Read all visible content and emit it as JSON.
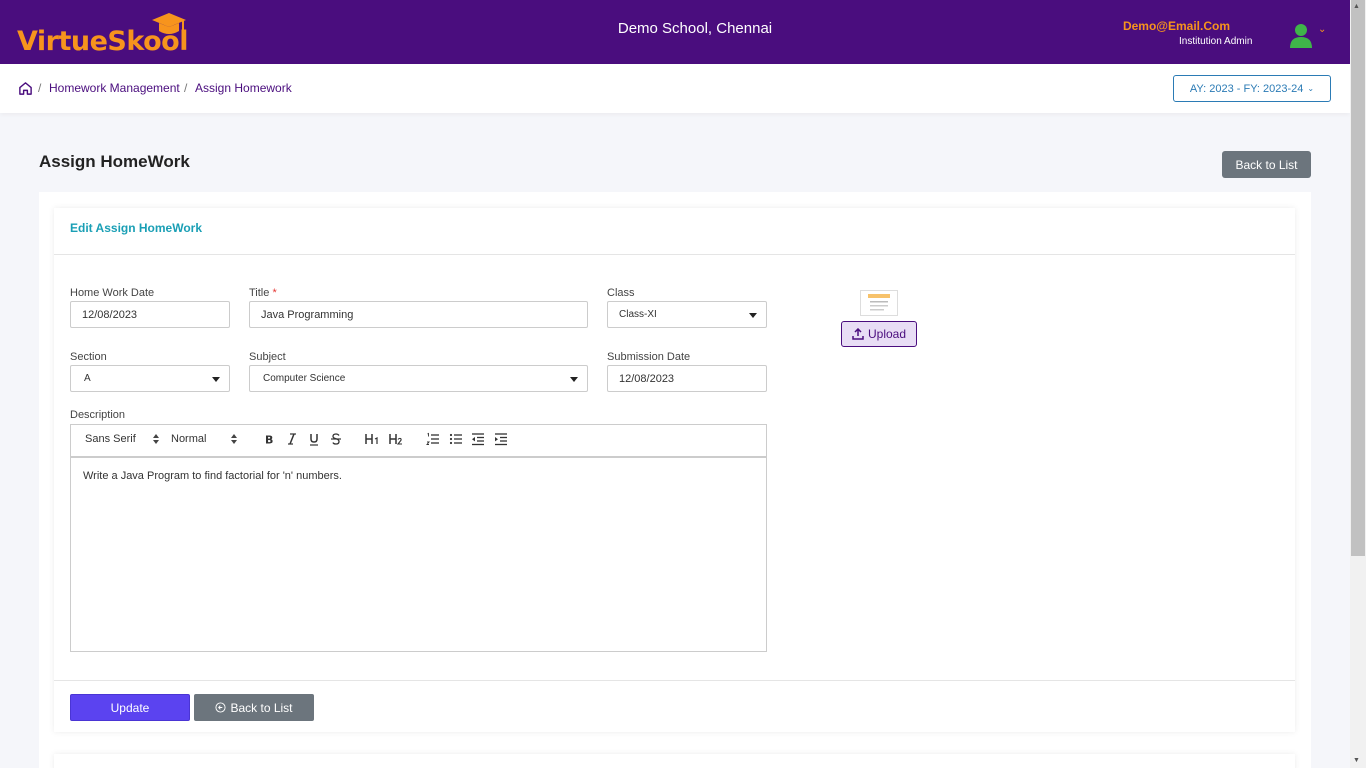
{
  "header": {
    "logo_text": "VirtueSkool",
    "school": "Demo School, Chennai",
    "user_email": "Demo@Email.Com",
    "user_role": "Institution Admin"
  },
  "breadcrumb": {
    "items": [
      "Homework Management",
      "Assign Homework"
    ],
    "separator": "/"
  },
  "academic_year": "AY: 2023 - FY: 2023-24",
  "page": {
    "title": "Assign HomeWork",
    "back_label": "Back to List"
  },
  "card": {
    "title": "Edit Assign HomeWork"
  },
  "form": {
    "homework_date": {
      "label": "Home Work Date",
      "value": "12/08/2023"
    },
    "title": {
      "label": "Title",
      "required_mark": "*",
      "value": "Java Programming"
    },
    "class": {
      "label": "Class",
      "value": "Class-XI"
    },
    "section": {
      "label": "Section",
      "value": "A"
    },
    "subject": {
      "label": "Subject",
      "value": "Computer Science"
    },
    "submission_date": {
      "label": "Submission Date",
      "value": "12/08/2023"
    },
    "description": {
      "label": "Description",
      "font": "Sans Serif",
      "size": "Normal",
      "content": "Write a Java Program to find factorial for 'n' numbers."
    }
  },
  "upload": {
    "label": "Upload"
  },
  "actions": {
    "update_label": "Update",
    "back_label": "Back to List"
  },
  "colors": {
    "brand": "#4a0d7e",
    "accent": "#f7941d",
    "primary_button": "#5b43f0",
    "secondary_button": "#6c757d",
    "card_title": "#1a9fb5"
  }
}
